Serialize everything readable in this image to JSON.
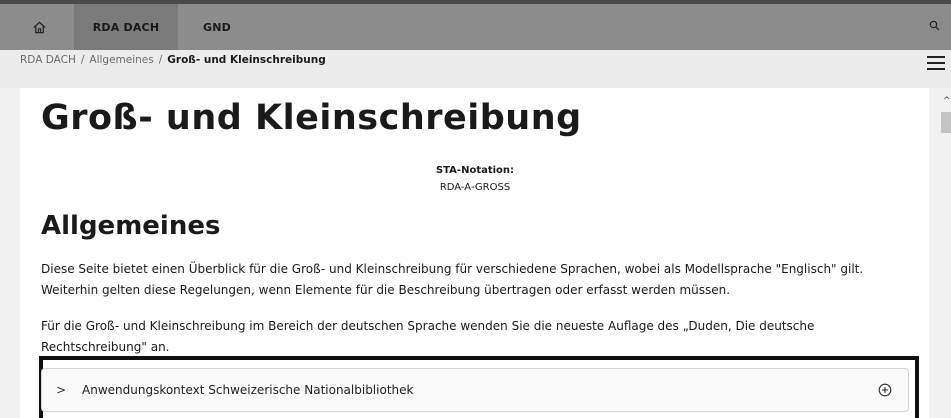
{
  "nav": {
    "tabs": [
      {
        "label": "RDA DACH"
      },
      {
        "label": "GND"
      }
    ]
  },
  "breadcrumb": {
    "items": [
      "RDA DACH",
      "Allgemeines"
    ],
    "current": "Groß- und Kleinschreibung",
    "separator": "/"
  },
  "page": {
    "title": "Groß- und Kleinschreibung",
    "sta_label": "STA-Notation:",
    "sta_value": "RDA-A-GROSS",
    "section_title": "Allgemeines",
    "paragraphs": [
      "Diese Seite bietet einen Überblick für die Groß- und Kleinschreibung für verschiedene Sprachen, wobei als Modellsprache \"Englisch\" gilt. Weiterhin gelten diese Regelungen, wenn Elemente für die Beschreibung übertragen oder erfasst werden müssen.",
      "Für die Groß- und Kleinschreibung im Bereich der deutschen Sprache wenden Sie die neueste Auflage des „Duden, Die deutsche Rechtschreibung\" an."
    ]
  },
  "accordion": {
    "chevron": ">",
    "label": "Anwendungskontext Schweizerische Nationalbibliothek",
    "icon": "plus-circle-icon"
  },
  "icons": {
    "home": "home-icon",
    "search": "search-icon",
    "menu": "hamburger-menu-icon"
  }
}
